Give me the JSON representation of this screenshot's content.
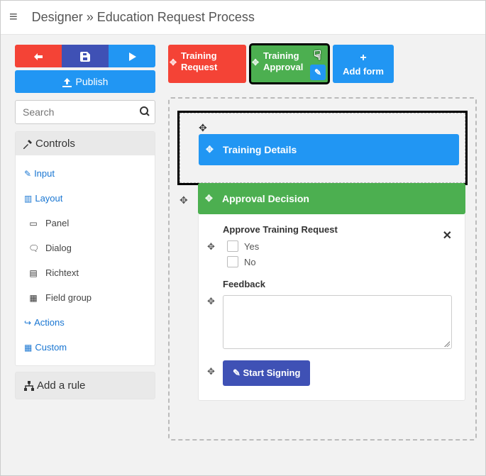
{
  "header": {
    "breadcrumb": "Designer » Education Request Process"
  },
  "toolbar": {
    "publish_label": "Publish"
  },
  "search": {
    "placeholder": "Search"
  },
  "sidebar": {
    "controls_title": "Controls",
    "input_label": "Input",
    "layout_label": "Layout",
    "layout_items": [
      {
        "label": "Panel",
        "icon": "▭"
      },
      {
        "label": "Dialog",
        "icon": "🗨"
      },
      {
        "label": "Richtext",
        "icon": "▤"
      },
      {
        "label": "Field group",
        "icon": "▦"
      }
    ],
    "actions_label": "Actions",
    "custom_label": "Custom",
    "add_rule_label": "Add a rule"
  },
  "tabs": {
    "request": "Training Request",
    "approval": "Training Approval",
    "add_form": "Add form"
  },
  "canvas": {
    "section1_title": "Training Details",
    "section2_title": "Approval Decision",
    "approve_label": "Approve Training Request",
    "option_yes": "Yes",
    "option_no": "No",
    "feedback_label": "Feedback",
    "start_signing": "Start Signing"
  }
}
